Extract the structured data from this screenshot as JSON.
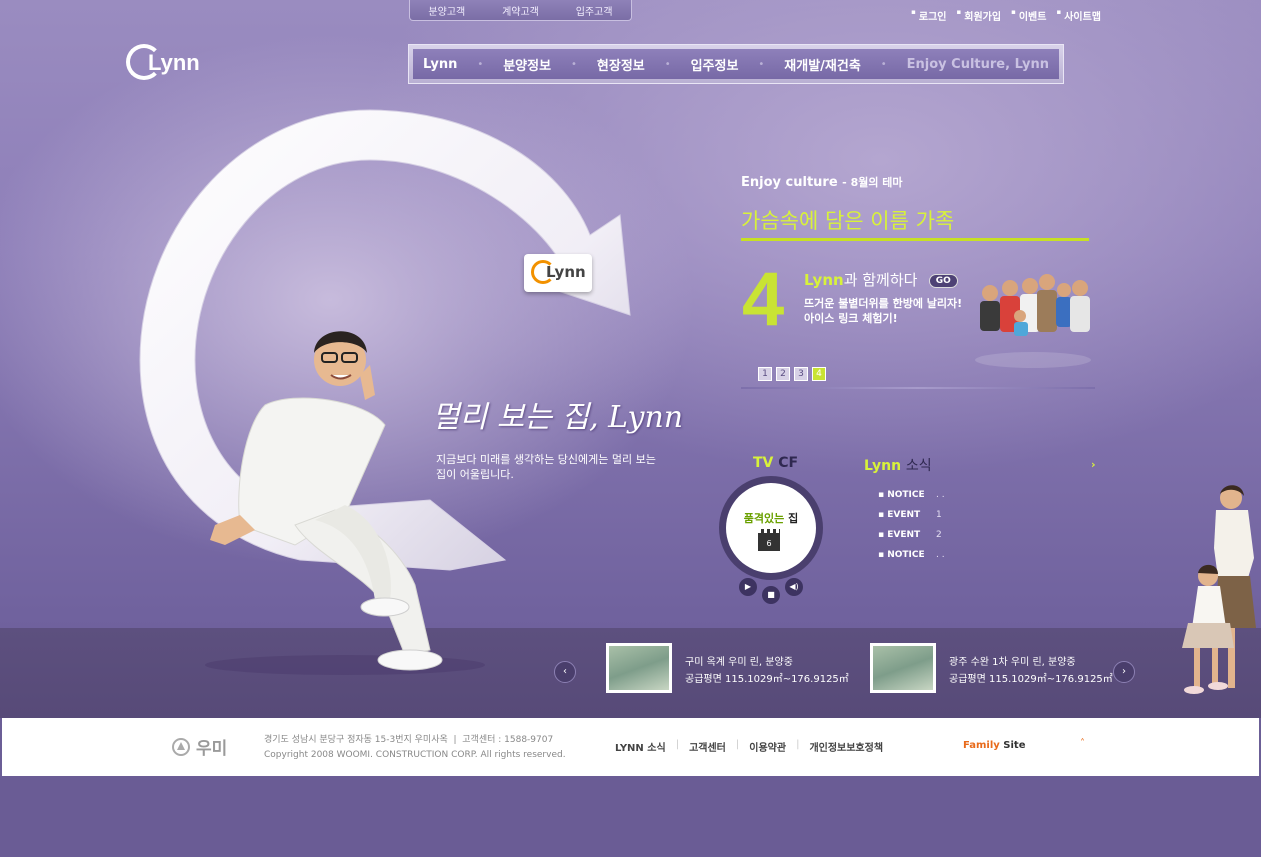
{
  "top_tabs": [
    "분양고객",
    "계약고객",
    "입주고객"
  ],
  "util_links": [
    "로그인",
    "회원가입",
    "이벤트",
    "사이트맵"
  ],
  "logo": "Lynn",
  "nav": {
    "items": [
      "Lynn",
      "분양정보",
      "현장정보",
      "입주정보",
      "재개발/재건축"
    ],
    "culture": "Enjoy Culture, Lynn"
  },
  "badge": "Lynn",
  "slogan": "멀리 보는 집, Lynn",
  "subcopy": "지금보다 미래를 생각하는 당신에게는 멀리 보는 집이 어울립니다.",
  "theme": {
    "head": "Enjoy culture",
    "head_sub": "- 8월의 테마",
    "title": "가슴속에 담은 이름 가족",
    "number": "4",
    "sub_brand": "Lynn",
    "sub_text": "과 함께하다",
    "go_label": "GO",
    "desc_line1": "뜨거운 불볕더위를 한방에 날리자!",
    "desc_line2": "아이스 링크 체험기!",
    "pages": [
      "1",
      "2",
      "3",
      "4"
    ],
    "active_page": 4
  },
  "tv": {
    "title_a": "TV",
    "title_b": "CF",
    "caption_a": "품격있는",
    "caption_b": "집",
    "clip_no": "6",
    "play": "▶",
    "stop": "■",
    "sound": "◀)"
  },
  "news": {
    "title_a": "Lynn",
    "title_b": "소식",
    "more": "›",
    "items": [
      {
        "tag": "NOTICE",
        "text": ". ."
      },
      {
        "tag": "EVENT",
        "text": "1"
      },
      {
        "tag": "EVENT",
        "text": "2"
      },
      {
        "tag": "NOTICE",
        "text": ". ."
      }
    ]
  },
  "projects": [
    {
      "name": "구미 옥계 우미 린, 분양중",
      "area": "공급평면 115.1029㎡~176.9125㎡"
    },
    {
      "name": "광주 수완 1차 우미 린, 분양중",
      "area": "공급평면 115.1029㎡~176.9125㎡"
    }
  ],
  "arrows": {
    "prev": "‹",
    "next": "›"
  },
  "footer": {
    "logo": "우미",
    "address": "경기도 성남시 분당구 정자동 15-3번지 우미사옥",
    "service": "고객센터 : 1588-9707",
    "copyright": "Copyright 2008  WOOMI. CONSTRUCTION CORP. All rights reserved.",
    "links": [
      "LYNN 소식",
      "고객센터",
      "이용약관",
      "개인정보보호정책"
    ],
    "family_a": "Family",
    "family_b": "Site",
    "up": "˄"
  }
}
